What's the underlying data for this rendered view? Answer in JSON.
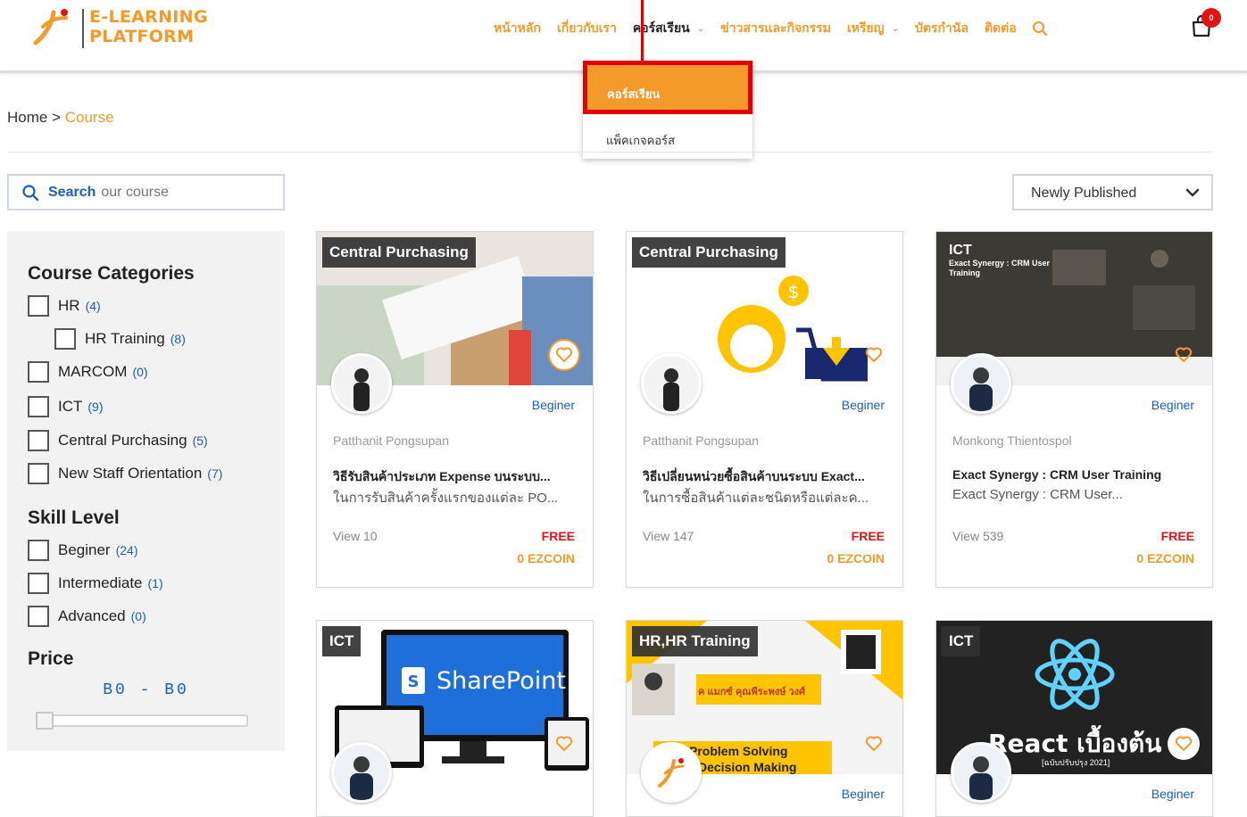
{
  "header": {
    "logo_line1": "E-LEARNING",
    "logo_line2": "PLATFORM",
    "nav": [
      {
        "label": "หน้าหลัก"
      },
      {
        "label": "เกี่ยวกับเรา"
      },
      {
        "label": "คอร์สเรียน",
        "active": true,
        "has_dropdown": true
      },
      {
        "label": "ข่าวสารและกิจกรรม"
      },
      {
        "label": "เหรียญ",
        "has_dropdown": true
      },
      {
        "label": "บัตรกำนัล"
      },
      {
        "label": "ติดต่อ"
      }
    ],
    "cart_count": "0"
  },
  "dropdown": {
    "item1": "คอร์สเรียน",
    "item2": "แพ็คเกจคอร์ส"
  },
  "breadcrumb": {
    "home": "Home",
    "separator": " > ",
    "current": "Course"
  },
  "search": {
    "label": "Search",
    "placeholder": "our course"
  },
  "sort": {
    "selected": "Newly Published"
  },
  "sidebar": {
    "categories_title": "Course Categories",
    "categories": [
      {
        "label": "HR",
        "count": "(4)"
      },
      {
        "label": "HR Training",
        "count": "(8)"
      },
      {
        "label": "MARCOM",
        "count": "(0)"
      },
      {
        "label": "ICT",
        "count": "(9)"
      },
      {
        "label": "Central Purchasing",
        "count": "(5)"
      },
      {
        "label": "New Staff Orientation",
        "count": "(7)"
      }
    ],
    "skill_title": "Skill Level",
    "skills": [
      {
        "label": "Beginer",
        "count": "(24)"
      },
      {
        "label": "Intermediate",
        "count": "(1)"
      },
      {
        "label": "Advanced",
        "count": "(0)"
      }
    ],
    "price_title": "Price",
    "price_range": "B0 - B0",
    "price_slider_value": 0
  },
  "cards": [
    {
      "category": "Central Purchasing",
      "level": "Beginer",
      "author": "Patthanit Pongsupan",
      "title1": "วิธีรับสินค้าประเภท Expense บนระบบ...",
      "title2": "ในการรับสินค้าครั้งแรกของแต่ละ PO...",
      "views": "View 10",
      "price": "FREE",
      "coin": "0 EZCOIN"
    },
    {
      "category": "Central Purchasing",
      "level": "Beginer",
      "author": "Patthanit Pongsupan",
      "title1": "วิธีเปลี่ยนหน่วยซื้อสินค้าบนระบบ Exact...",
      "title2": "ในการซื้อสินค้าแต่ละชนิดหรือแต่ละค...",
      "views": "View 147",
      "price": "FREE",
      "coin": "0 EZCOIN"
    },
    {
      "category": "ICT",
      "thumb_text": "Exact Synergy : CRM User Training",
      "level": "Beginer",
      "author": "Monkong Thientospol",
      "title1": "Exact Synergy : CRM User Training",
      "title2": "Exact Synergy : CRM User...",
      "views": "View 539",
      "price": "FREE",
      "coin": "0 EZCOIN"
    },
    {
      "category": "ICT",
      "thumb_text": "SharePoint"
    },
    {
      "category": "HR,HR Training",
      "thumb_name": "ค แมกซ์ คุณพีระพงษ์ วงศ์",
      "thumb_text1": "Problem Solving",
      "thumb_text2": "Decision Making",
      "level": "Beginer"
    },
    {
      "category": "ICT",
      "thumb_text": "React เบื้องต้น",
      "thumb_sub": "[ฉบับปรับปรุง 2021]",
      "level": "Beginer"
    }
  ]
}
